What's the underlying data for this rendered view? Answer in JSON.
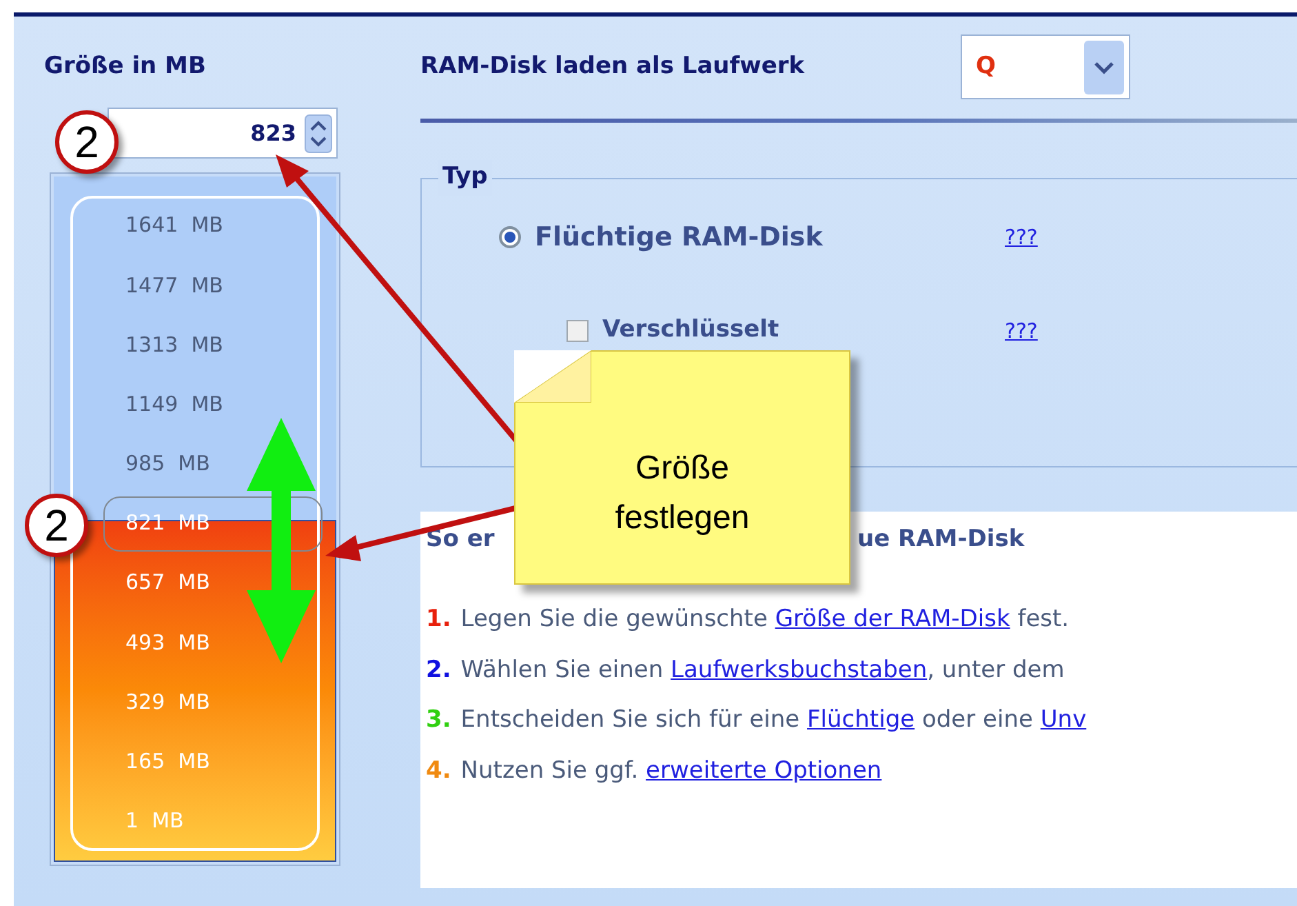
{
  "size_panel": {
    "title": "Größe in MB",
    "value": "823",
    "scale": {
      "labels": [
        "1641  MB",
        "1477  MB",
        "1313  MB",
        "1149  MB",
        "985  MB",
        "821  MB",
        "657  MB",
        "493  MB",
        "329  MB",
        "165  MB",
        "1  MB"
      ],
      "level": 0.5
    }
  },
  "drive": {
    "label": "RAM-Disk laden als Laufwerk",
    "value": "Q"
  },
  "type_group": {
    "title": "Typ",
    "options": [
      {
        "kind": "radio",
        "label": "Flüchtige RAM-Disk",
        "selected": true,
        "help": "???"
      },
      {
        "kind": "checkbox",
        "label": "Verschlüsselt",
        "checked": false,
        "help": "???"
      }
    ]
  },
  "info": {
    "heading_parts": [
      "So er",
      "ue RAM-Disk"
    ],
    "steps": [
      {
        "number": "1.",
        "color": "#e8200c",
        "parts": [
          {
            "kind": "text",
            "text": "Legen Sie die gewünschte "
          },
          {
            "kind": "link",
            "text": "Größe der RAM-Disk"
          },
          {
            "kind": "text",
            "text": " fest."
          }
        ]
      },
      {
        "number": "2.",
        "color": "#1010e0",
        "parts": [
          {
            "kind": "text",
            "text": "Wählen Sie einen "
          },
          {
            "kind": "link",
            "text": "Laufwerksbuchstaben"
          },
          {
            "kind": "text",
            "text": ", unter dem"
          }
        ]
      },
      {
        "number": "3.",
        "color": "#30d010",
        "parts": [
          {
            "kind": "text",
            "text": "Entscheiden Sie sich für eine "
          },
          {
            "kind": "link",
            "text": "Flüchtige"
          },
          {
            "kind": "text",
            "text": " oder eine "
          },
          {
            "kind": "link",
            "text": "Unv"
          }
        ]
      },
      {
        "number": "4.",
        "color": "#f08a10",
        "parts": [
          {
            "kind": "text",
            "text": "Nutzen Sie ggf. "
          },
          {
            "kind": "link",
            "text": "erweiterte Optionen"
          }
        ]
      }
    ]
  },
  "annotations": {
    "note": [
      "Größe",
      "festlegen"
    ],
    "badges": [
      "2",
      "2"
    ]
  }
}
